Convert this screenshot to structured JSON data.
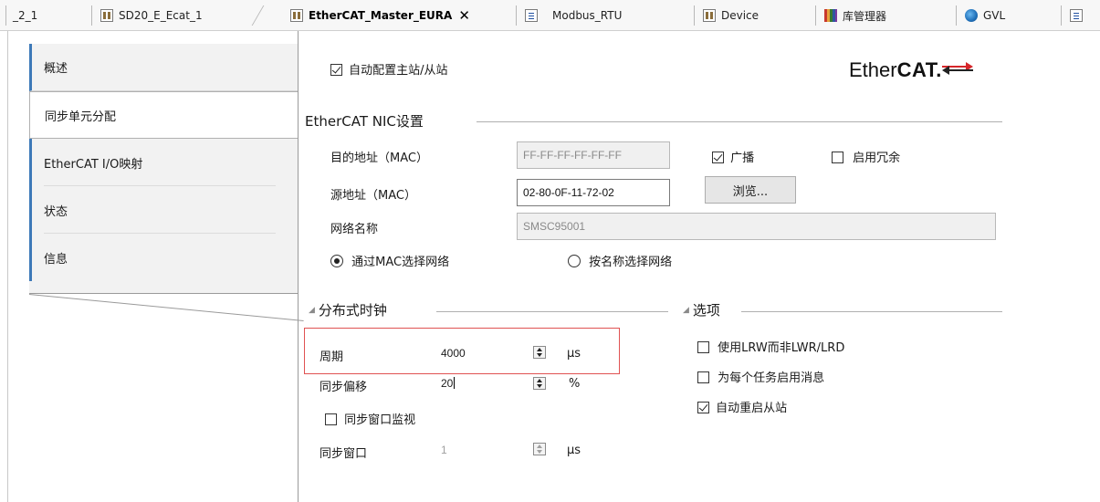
{
  "tabs": [
    {
      "label": "_2_1",
      "icon": "none"
    },
    {
      "label": "SD20_E_Ecat_1",
      "icon": "device-icon"
    },
    {
      "label": "EtherCAT_Master_EURA",
      "icon": "device-icon",
      "active": true,
      "close": "✕"
    },
    {
      "label": "Modbus_RTU",
      "icon": "document-icon"
    },
    {
      "label": "Device",
      "icon": "device-icon"
    },
    {
      "label": "库管理器",
      "icon": "library-icon"
    },
    {
      "label": "GVL",
      "icon": "globe-icon"
    }
  ],
  "sidebar": {
    "items": [
      {
        "label": "概述"
      },
      {
        "label": "同步单元分配",
        "selected": true
      },
      {
        "label": "EtherCAT I/O映射"
      },
      {
        "label": "状态"
      },
      {
        "label": "信息"
      }
    ]
  },
  "master": {
    "auto_config_label": "自动配置主站/从站",
    "auto_config_checked": true,
    "logo_text_plain": "Ether",
    "logo_text_bold": "CAT."
  },
  "nic": {
    "group_title": "EtherCAT NIC设置",
    "dest_label": "目的地址（MAC）",
    "dest_value": "FF-FF-FF-FF-FF-FF",
    "broadcast_label": "广播",
    "broadcast_checked": true,
    "redundancy_label": "启用冗余",
    "redundancy_checked": false,
    "src_label": "源地址（MAC）",
    "src_value": "02-80-0F-11-72-02",
    "browse_label": "浏览...",
    "netname_label": "网络名称",
    "netname_value": "SMSC95001",
    "select_by_mac_label": "通过MAC选择网络",
    "select_by_name_label": "按名称选择网络",
    "select_mode": "mac"
  },
  "dc": {
    "group_title": "分布式时钟",
    "cycle_label": "周期",
    "cycle_value": "4000",
    "cycle_unit": "µs",
    "shift_label": "同步偏移",
    "shift_value": "20",
    "shift_unit": "%",
    "window_monitor_label": "同步窗口监视",
    "window_monitor_checked": false,
    "window_label": "同步窗口",
    "window_value": "1",
    "window_unit": "µs"
  },
  "options": {
    "group_title": "选项",
    "lrw_label": "使用LRW而非LWR/LRD",
    "lrw_checked": false,
    "msg_label": "为每个任务启用消息",
    "msg_checked": false,
    "autorestart_label": "自动重启从站",
    "autorestart_checked": true
  },
  "colors": {
    "accent_blue": "#3d79b8",
    "highlight_red": "#e05252",
    "logo_red": "#d6262a"
  }
}
